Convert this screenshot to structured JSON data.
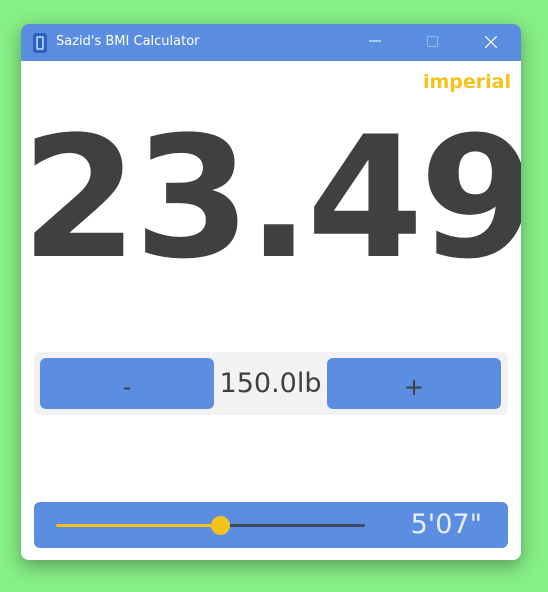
{
  "window": {
    "title": "Sazid's BMI Calculator",
    "app_icon": "app-icon"
  },
  "unit_toggle": {
    "label": "imperial",
    "color": "#f5c21c"
  },
  "bmi": {
    "value": "23.49"
  },
  "weight": {
    "decrement_label": "-",
    "value": "150.0lb",
    "increment_label": "+"
  },
  "height": {
    "value": "5'07\"",
    "slider_fraction": 0.53
  },
  "colors": {
    "accent": "#5b8ee0",
    "highlight": "#f5c21c",
    "text": "#404040",
    "background": "#86ef86"
  }
}
